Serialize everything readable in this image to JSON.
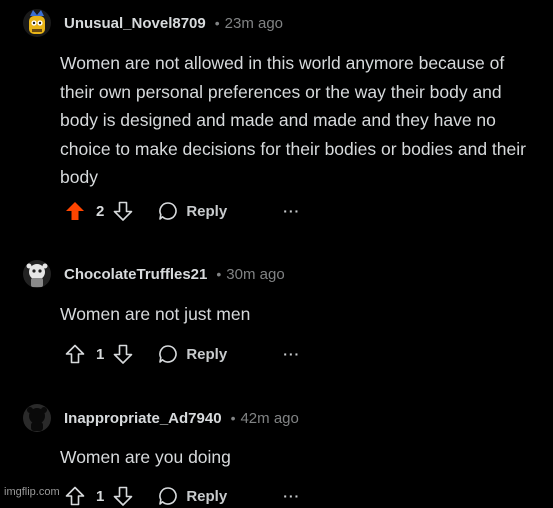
{
  "comments": [
    {
      "username": "Unusual_Novel8709",
      "separator": "•",
      "time": "23m ago",
      "body": "Women are not allowed in this world anymore because of their own personal preferences or the way their body and body is designed and made and made and they have no choice to make decisions for their bodies or bodies and their body",
      "votes": "2",
      "upvoted": true,
      "reply_label": "Reply",
      "more_label": "···",
      "avatar_icon": "snoo-yellow-avatar-icon"
    },
    {
      "username": "ChocolateTruffles21",
      "separator": "•",
      "time": "30m ago",
      "body": "Women are not just men",
      "votes": "1",
      "upvoted": false,
      "reply_label": "Reply",
      "more_label": "···",
      "avatar_icon": "snoo-gray-avatar-icon"
    },
    {
      "username": "Inappropriate_Ad7940",
      "separator": "•",
      "time": "42m ago",
      "body": "Women are you doing",
      "votes": "1",
      "upvoted": false,
      "reply_label": "Reply",
      "more_label": "···",
      "avatar_icon": "snoo-black-avatar-icon"
    }
  ],
  "colors": {
    "upvote_active": "#ff4500",
    "text": "#d7dadc",
    "meta": "#818384",
    "background": "#000000"
  },
  "watermark": "imgflip.com"
}
